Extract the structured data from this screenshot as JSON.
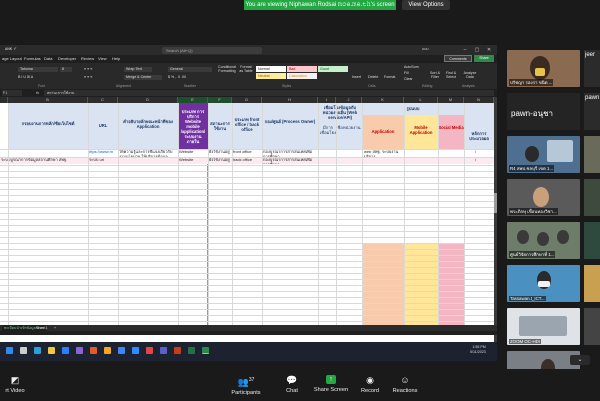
{
  "banner": "You are viewing Niphawan Rodsai 𝚖𝚘𝚎.𝚖𝚎.𝚝𝚑's screen",
  "view_options": "View Options",
  "excel": {
    "app_name": "ᴀɴᴋ ✓",
    "search": "Search (Alt+Q)",
    "user": "ᴜᴜᴜ",
    "menu_tabs": [
      "age Layout",
      "Formulas",
      "Data",
      "Developer",
      "Review",
      "View",
      "Help"
    ],
    "comments": "Comments",
    "share": "Share",
    "ribbon": {
      "font_name": "Tahoma",
      "font_size": "8",
      "wrap_text": "Wrap Text",
      "merge_center": "Merge & Center",
      "number_format": "General",
      "conditional": "Conditional Formatting",
      "format_table": "Format as Table",
      "styles": [
        "Normal",
        "Bad",
        "Good",
        "Neutral",
        "Calculation"
      ],
      "autosum": "AutoSum",
      "fill": "Fill",
      "clear": "Clear",
      "insert": "Insert",
      "delete": "Delete",
      "format": "Format",
      "sort": "Sort & Filter",
      "find": "Find & Select",
      "analyze": "Analyze Data",
      "groups": [
        "Font",
        "Alignment",
        "Number",
        "Styles",
        "Cells",
        "Editing",
        "Analysis"
      ]
    },
    "name_box": "F1",
    "fx": "fx",
    "formula": "สถานะการใช้งาน",
    "columns": [
      "A",
      "B",
      "C",
      "D",
      "E",
      "F",
      "G",
      "H",
      "I",
      "J",
      "K",
      "L",
      "M",
      "N"
    ],
    "headers": {
      "name": "กรอบงานการหลัก/ชื่อเว็บไซต์",
      "url": "URL",
      "desc": "คำอธิบายลักษณะหน้าที่ของ Application",
      "type": "ประเภท การบริการ Website mobile /application/ ระบบงานภายใน",
      "status": "สถานะการใช้งาน",
      "front": "ประเภท front office / back office",
      "owner": "กอง/ศูนย์ (Process Owner)",
      "integration": "เชื่อมโยงข้อมูลกับหน่วยงานอื่น (Web service/API)",
      "int_detail": "มีการเชื่อมโยง",
      "int_agency": "ชื่อหน่วยงาน",
      "platform": "รูปแบบ",
      "app": "Application",
      "mobile": "Mobile Application",
      "social": "Social Media",
      "remark": "หลักการ ประมวลผล"
    },
    "rows": [
      {
        "name": "",
        "url": "https://www.m",
        "desc": "ให้ความรู้และการชี้แจงเกี่ยวกับ งานนโยบาย ให้บริการข้อมูลข่าวสาร",
        "type": "Website",
        "status": "ยังใช้งานอยู่",
        "front": "front office",
        "owner": "กองบูรณาการสารสนเทศเพื่อการศึกษา",
        "app": "web สพฐ. ระบบงานบริการ",
        "remark": "/"
      },
      {
        "name": "ระบบบูรณาการข้อมูลสถานศึกษา สพฐ.",
        "url": "ระบบ url",
        "desc": "",
        "type": "Website",
        "status": "ยังใช้งานอยู่",
        "front": "back office",
        "owner": "กองบูรณาการสารสนเทศเพื่อการศึกษา",
        "app": "",
        "remark": "/"
      }
    ],
    "sheets": [
      "ทะเบียนนำเข้าข้อมูลระบบ",
      "Sheet1",
      "+"
    ],
    "status_bar": "Ready"
  },
  "taskbar": {
    "time": "1:55 PM",
    "date": "5/11/2023"
  },
  "participants": [
    {
      "label": "ปรัชญา รองรา ขนิด ...",
      "kind": "video"
    },
    {
      "label": "pawn-อนุชา",
      "kind": "name"
    },
    {
      "label": "R4 สพป.ชลบุรี เขต 1...",
      "kind": "video"
    },
    {
      "label": "พระภิกษุ เขื่อนทองวิชา...",
      "kind": "video"
    },
    {
      "label": "ศูนย์วิจัยการศึกษาที่ 1...",
      "kind": "video"
    },
    {
      "label": "Tassawan.t_ICT...",
      "kind": "video"
    },
    {
      "label": "ZOOM OC-HDI",
      "kind": "video"
    },
    {
      "label": "",
      "kind": "video"
    }
  ],
  "side_names": [
    "jeer",
    "pawn",
    "",
    "",
    "",
    "",
    "",
    ""
  ],
  "toolbar": {
    "video": "rt Video",
    "participants": "Participants",
    "participant_count": "37",
    "chat": "Chat",
    "share": "Share Screen",
    "record": "Record",
    "reactions": "Reactions"
  },
  "colors": {
    "banner_green": "#23a843",
    "excel_green": "#2f8a4a",
    "header_purple": "#7030a0",
    "header_orange": "#f8cbad",
    "header_yellow": "#ffe699",
    "header_pink": "#f4b6c2",
    "header_blue": "#d9e3f1"
  }
}
